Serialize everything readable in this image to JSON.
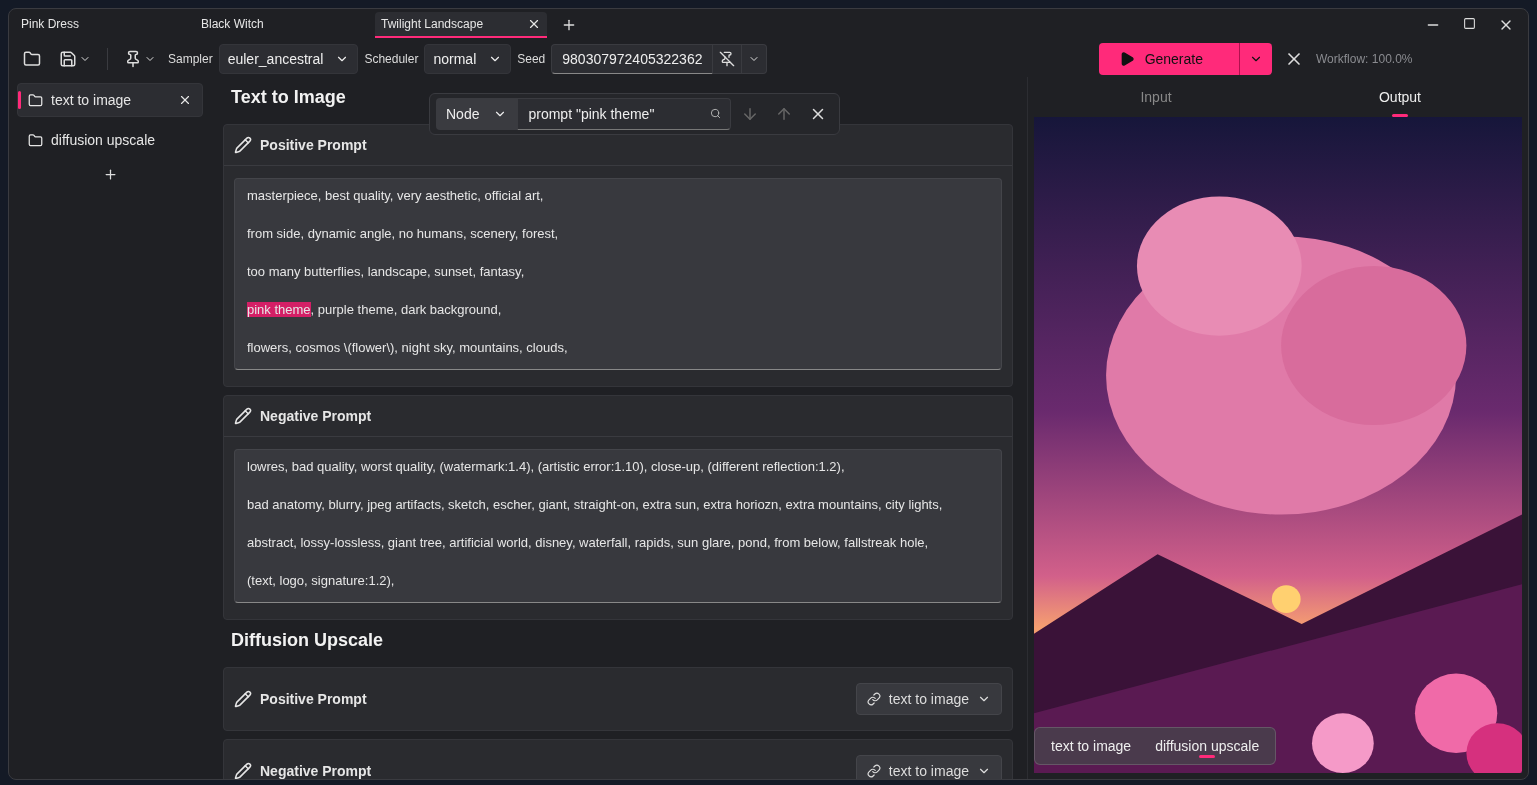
{
  "doc_tabs": [
    {
      "label": "Pink Dress",
      "selected": false
    },
    {
      "label": "Black Witch",
      "selected": false
    },
    {
      "label": "Twilight Landscape",
      "selected": true
    }
  ],
  "toolbar": {
    "sampler_label": "Sampler",
    "sampler": "euler_ancestral",
    "scheduler_label": "Scheduler",
    "scheduler": "normal",
    "seed_label": "Seed",
    "seed": "980307972405322362",
    "generate": "Generate",
    "workflow_status": "Workflow: 100.0%"
  },
  "sidebar": {
    "items": [
      {
        "label": "text to image",
        "selected": true
      },
      {
        "label": "diffusion upscale",
        "selected": false
      }
    ]
  },
  "search": {
    "scope": "Node",
    "query": "prompt \"pink theme\""
  },
  "sections": [
    {
      "title": "Text to Image",
      "cards": [
        {
          "title": "Positive Prompt",
          "lines": [
            [
              {
                "text": "masterpiece, best quality, very aesthetic, official art,",
                "highlighted": false
              }
            ],
            [
              {
                "text": "from side, dynamic angle, no humans, scenery, forest,",
                "highlighted": false
              }
            ],
            [
              {
                "text": "too many butterflies, landscape, sunset, fantasy,",
                "highlighted": false
              }
            ],
            [
              {
                "text": "pink theme",
                "highlighted": true
              },
              {
                "text": ", purple theme, dark background,",
                "highlighted": false
              }
            ],
            [
              {
                "text": "flowers, cosmos \\(flower\\), night sky, mountains, clouds,",
                "highlighted": false
              }
            ]
          ]
        },
        {
          "title": "Negative Prompt",
          "lines": [
            [
              {
                "text": "lowres, bad quality, worst quality, (watermark:1.4), (artistic error:1.10), close-up, (different reflection:1.2),",
                "highlighted": false
              }
            ],
            [
              {
                "text": "bad anatomy, blurry, jpeg artifacts, sketch, escher, giant, straight-on, extra sun, extra horiozn, extra mountains, city lights,",
                "highlighted": false
              }
            ],
            [
              {
                "text": "abstract, lossy-lossless, giant tree, artificial world, disney, waterfall, rapids, sun glare, pond, from below, fallstreak hole,",
                "highlighted": false
              }
            ],
            [
              {
                "text": "(text, logo, signature:1.2),",
                "highlighted": false
              }
            ]
          ]
        }
      ]
    },
    {
      "title": "Diffusion Upscale",
      "cards": [
        {
          "title": "Positive Prompt",
          "link": "text to image"
        },
        {
          "title": "Negative Prompt",
          "link": "text to image"
        }
      ]
    }
  ],
  "preview": {
    "tabs": [
      {
        "label": "Input",
        "selected": false
      },
      {
        "label": "Output",
        "selected": true
      }
    ],
    "results": [
      {
        "label": "text to image",
        "selected": false
      },
      {
        "label": "diffusion upscale",
        "selected": true
      }
    ]
  }
}
